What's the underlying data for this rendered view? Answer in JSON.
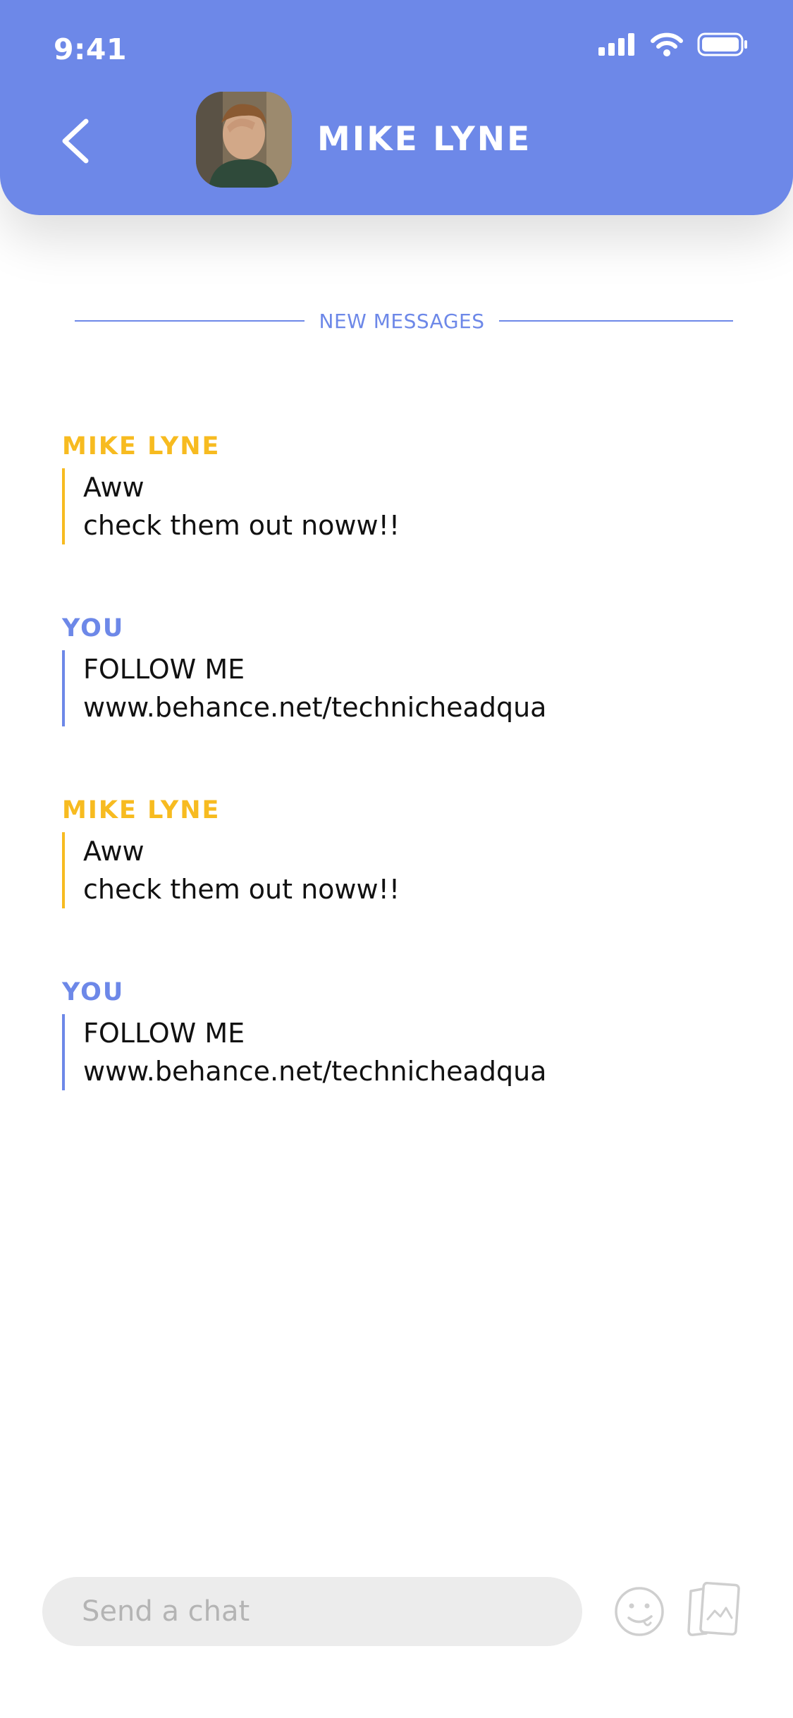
{
  "status_bar": {
    "time": "9:41"
  },
  "header": {
    "contact_name": "MIKE LYNE"
  },
  "divider": {
    "label": "NEW MESSAGES"
  },
  "messages": [
    {
      "sender": "MIKE LYNE",
      "from_self": false,
      "lines": [
        "Aww",
        "check them out noww!!"
      ]
    },
    {
      "sender": "YOU",
      "from_self": true,
      "lines": [
        "FOLLOW ME",
        "www.behance.net/technicheadqua"
      ]
    },
    {
      "sender": "MIKE LYNE",
      "from_self": false,
      "lines": [
        "Aww",
        "check them out noww!!"
      ]
    },
    {
      "sender": "YOU",
      "from_self": true,
      "lines": [
        "FOLLOW ME",
        "www.behance.net/technicheadqua"
      ]
    }
  ],
  "composer": {
    "placeholder": "Send a chat"
  },
  "icons": {
    "back": "chevron-left-icon",
    "emoji": "emoji-icon",
    "gallery": "photo-gallery-icon",
    "signal": "signal-icon",
    "wifi": "wifi-icon",
    "battery": "battery-icon"
  },
  "colors": {
    "brand": "#6d88e8",
    "contact_accent": "#f7bb20",
    "input_background": "#ececec"
  }
}
